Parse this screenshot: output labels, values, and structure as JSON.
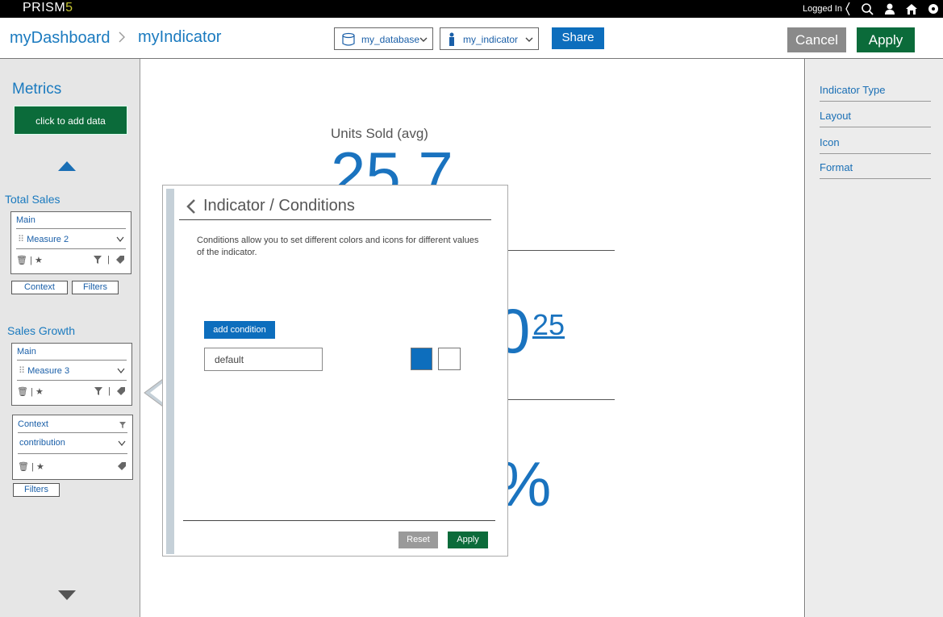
{
  "topbar": {
    "logo_text": "PRISM",
    "logo_version": "5",
    "logged_in_text": "Logged In",
    "icons": [
      "search-icon",
      "user-icon",
      "home-icon",
      "settings-icon"
    ]
  },
  "header": {
    "breadcrumb_root": "myDashboard",
    "breadcrumb_current": "myIndicator",
    "database_select": "my_database",
    "indicator_select": "my_indicator",
    "share_label": "Share",
    "cancel_label": "Cancel",
    "apply_label": "Apply"
  },
  "left": {
    "metrics_title": "Metrics",
    "add_data_label": "click to add data",
    "groups": [
      {
        "title": "Total Sales",
        "box_title": "Main",
        "measure": "Measure 2",
        "context_btn": "Context",
        "filters_btn": "Filters"
      },
      {
        "title": "Sales Growth",
        "box_title": "Main",
        "measure": "Measure 3",
        "context_box_title": "Context",
        "context_value": "contribution",
        "filters_btn": "Filters"
      }
    ]
  },
  "canvas": {
    "indicator_label": "Units Sold (avg)",
    "big_value_1": "25.7",
    "big_value_2": "0",
    "big_value_2_sup": "25",
    "big_value_3": "%"
  },
  "right": {
    "items": [
      "Indicator Type",
      "Layout",
      "Icon",
      "Format"
    ]
  },
  "popup": {
    "title": "Indicator / Conditions",
    "description": "Conditions allow you to set different colors and icons for different values of the indicator.",
    "add_condition_label": "add condition",
    "condition_default_value": "default",
    "reset_label": "Reset",
    "apply_label": "Apply"
  },
  "colors": {
    "accent_blue": "#0d6ebd",
    "brand_green": "#0b6b3a",
    "link_blue": "#1a7abf"
  }
}
